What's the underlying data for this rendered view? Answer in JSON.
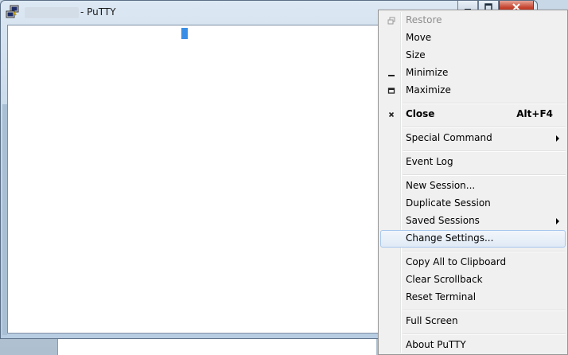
{
  "window": {
    "title": "- PuTTY",
    "buttons": {
      "minimize_icon": "minimize-icon",
      "maximize_icon": "maximize-icon",
      "close_icon": "close-icon"
    }
  },
  "context_menu": {
    "items": [
      {
        "label": "Restore",
        "disabled": true,
        "icon": "restore-icon"
      },
      {
        "label": "Move"
      },
      {
        "label": "Size"
      },
      {
        "label": "Minimize",
        "icon": "minimize-icon"
      },
      {
        "label": "Maximize",
        "icon": "maximize-icon"
      },
      {
        "label": "Close",
        "bold": true,
        "shortcut": "Alt+F4",
        "icon": "close-icon"
      },
      {
        "label": "Special Command",
        "submenu": true
      },
      {
        "label": "Event Log"
      },
      {
        "label": "New Session..."
      },
      {
        "label": "Duplicate Session"
      },
      {
        "label": "Saved Sessions",
        "submenu": true
      },
      {
        "label": "Change Settings...",
        "highlighted": true
      },
      {
        "label": "Copy All to Clipboard"
      },
      {
        "label": "Clear Scrollback"
      },
      {
        "label": "Reset Terminal"
      },
      {
        "label": "Full Screen"
      },
      {
        "label": "About PuTTY"
      }
    ]
  },
  "colors": {
    "close_button": "#c5432e",
    "cursor": "#3a8ee6",
    "menu_highlight_border": "#a8c7ec"
  }
}
